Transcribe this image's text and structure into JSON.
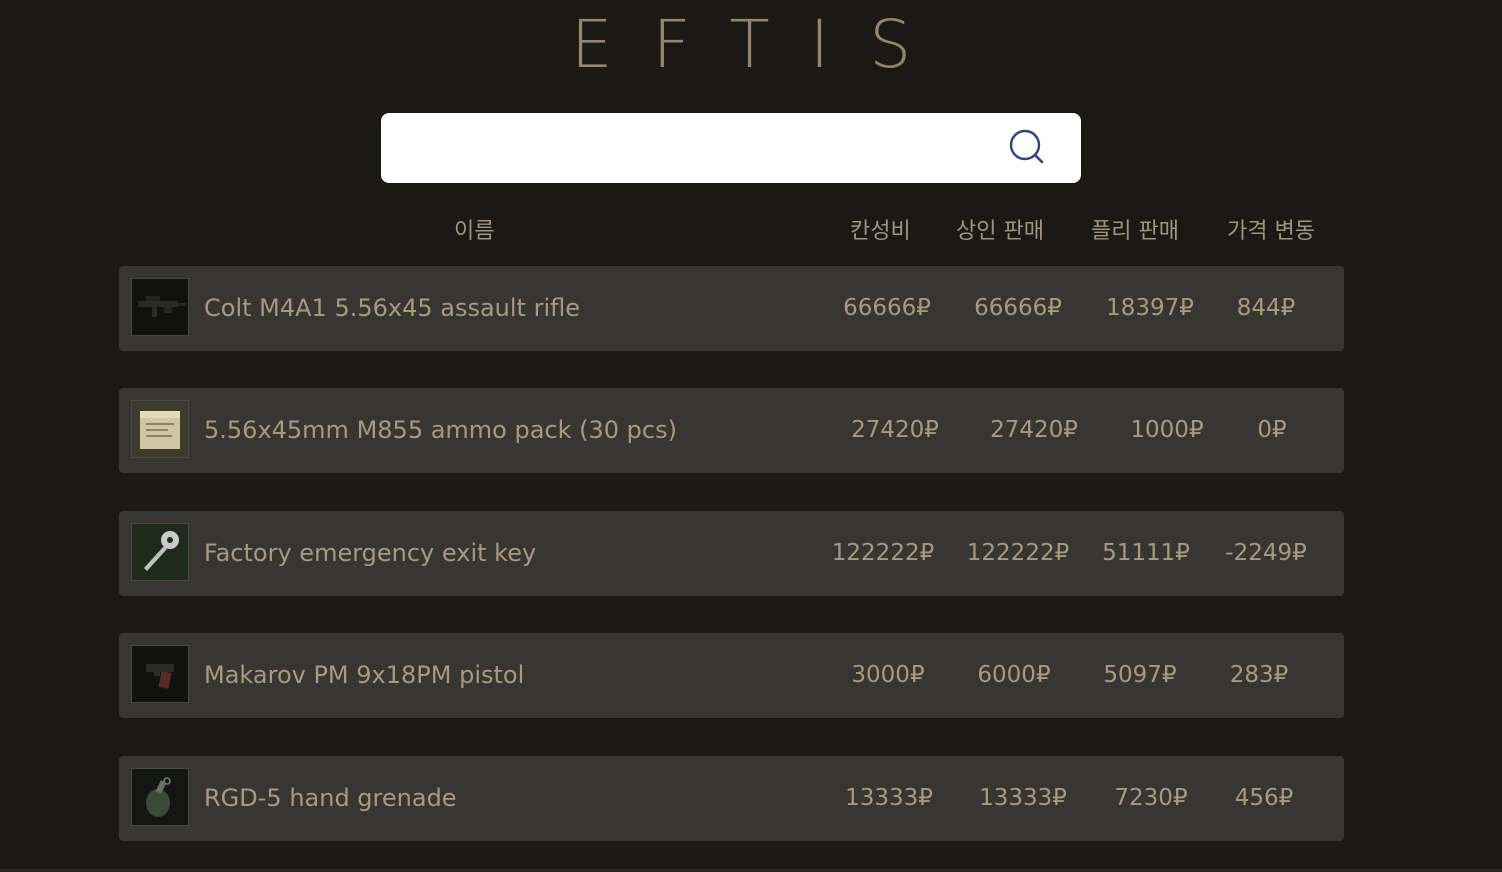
{
  "app": {
    "logo": "EFTIS"
  },
  "search": {
    "value": "",
    "placeholder": "",
    "icon": "search-icon",
    "icon_color": "#2f3e8f"
  },
  "table": {
    "headers": {
      "name": "이름",
      "value_ratio": "칸성비",
      "trader_sell": "상인 판매",
      "flea_sell": "플리 판매",
      "price_change": "가격 변동"
    },
    "rows": [
      {
        "name": "Colt M4A1 5.56x45 assault rifle",
        "icon": "rifle-icon",
        "value_ratio": "66666₽",
        "trader_sell": "66666₽",
        "flea_sell": "18397₽",
        "price_change": "844₽"
      },
      {
        "name": "5.56x45mm M855 ammo pack (30 pcs)",
        "icon": "ammo-pack-icon",
        "value_ratio": "27420₽",
        "trader_sell": "27420₽",
        "flea_sell": "1000₽",
        "price_change": "0₽"
      },
      {
        "name": "Factory emergency exit key",
        "icon": "key-icon",
        "value_ratio": "122222₽",
        "trader_sell": "122222₽",
        "flea_sell": "51111₽",
        "price_change": "-2249₽"
      },
      {
        "name": "Makarov PM 9x18PM pistol",
        "icon": "pistol-icon",
        "value_ratio": "3000₽",
        "trader_sell": "6000₽",
        "flea_sell": "5097₽",
        "price_change": "283₽"
      },
      {
        "name": "RGD-5 hand grenade",
        "icon": "grenade-icon",
        "value_ratio": "13333₽",
        "trader_sell": "13333₽",
        "flea_sell": "7230₽",
        "price_change": "456₽"
      }
    ]
  },
  "colors": {
    "background": "#1b1915",
    "row_background": "#383633",
    "text": "#a89a7c",
    "logo": "#958668"
  }
}
